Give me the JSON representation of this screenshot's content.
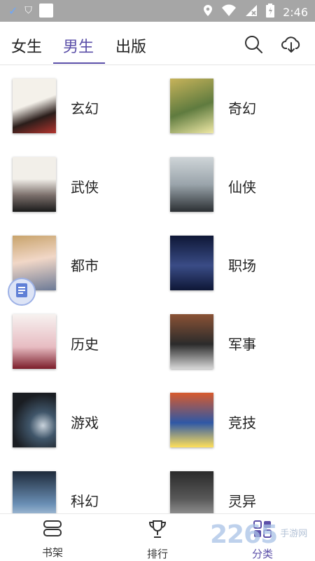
{
  "status_bar": {
    "time": "2:46"
  },
  "top_tabs": [
    {
      "label": "女生",
      "active": false
    },
    {
      "label": "男生",
      "active": true
    },
    {
      "label": "出版",
      "active": false
    }
  ],
  "categories": [
    {
      "label": "玄幻",
      "cover_colors": [
        "#f4f1ea",
        "#2a1d1a",
        "#b3342e"
      ]
    },
    {
      "label": "奇幻",
      "cover_colors": [
        "#c7b35a",
        "#5f7b3f",
        "#f0e9a6"
      ]
    },
    {
      "label": "武侠",
      "cover_colors": [
        "#f2efe9",
        "#1a1a1a",
        "#7a6e6a"
      ]
    },
    {
      "label": "仙侠",
      "cover_colors": [
        "#cfd5d8",
        "#2b2f33",
        "#9aa4ab"
      ]
    },
    {
      "label": "都市",
      "cover_colors": [
        "#f1d7c7",
        "#6c7a96",
        "#c8a36b"
      ]
    },
    {
      "label": "职场",
      "cover_colors": [
        "#0e1736",
        "#3a4c86",
        "#f6e34a"
      ]
    },
    {
      "label": "历史",
      "cover_colors": [
        "#f7f2f0",
        "#7b1d2a",
        "#e7bcc2"
      ]
    },
    {
      "label": "军事",
      "cover_colors": [
        "#2b2b2b",
        "#8a5235",
        "#d6d6d6"
      ]
    },
    {
      "label": "游戏",
      "cover_colors": [
        "#1a1d22",
        "#40566a",
        "#c9d3dc"
      ]
    },
    {
      "label": "竞技",
      "cover_colors": [
        "#d85a2d",
        "#2e58a6",
        "#ffe05a"
      ]
    },
    {
      "label": "科幻",
      "cover_colors": [
        "#1e2a3a",
        "#6a8fb5",
        "#d9e6f3"
      ]
    },
    {
      "label": "灵异",
      "cover_colors": [
        "#2a2a2a",
        "#585858",
        "#b9b9b9"
      ]
    }
  ],
  "bottom_nav": [
    {
      "label": "书架",
      "icon": "bookshelf-icon",
      "active": false
    },
    {
      "label": "排行",
      "icon": "trophy-icon",
      "active": false
    },
    {
      "label": "分类",
      "icon": "category-grid-icon",
      "active": true
    }
  ],
  "watermark": {
    "number": "2265",
    "line1": "手游网",
    "line2": ""
  }
}
